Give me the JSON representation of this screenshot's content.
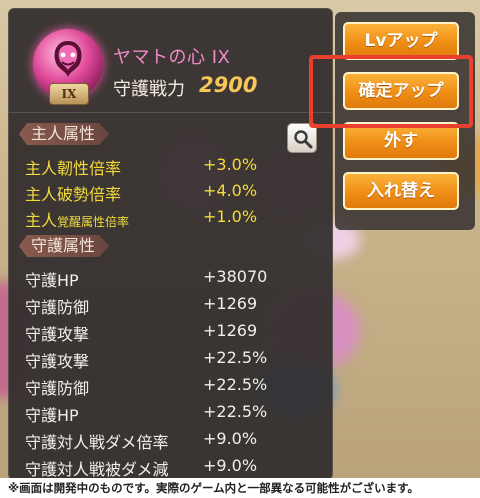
{
  "item": {
    "name": "ヤマトの心 IX",
    "rank": "IX",
    "power_label": "守護戦力",
    "power_value": "2900"
  },
  "owner_section": {
    "title": "主人属性",
    "rows": [
      {
        "label": "主人韌性倍率",
        "value": "+3.0%"
      },
      {
        "label": "主人破勢倍率",
        "value": "+4.0%"
      },
      {
        "label_main": "主人",
        "label_small": "覚醒属性倍率",
        "value": "+1.0%"
      }
    ]
  },
  "guard_section": {
    "title": "守護属性",
    "rows": [
      {
        "label": "守護HP",
        "value": "+38070"
      },
      {
        "label": "守護防御",
        "value": "+1269"
      },
      {
        "label": "守護攻撃",
        "value": "+1269"
      },
      {
        "label": "守護攻撃",
        "value": "+22.5%"
      },
      {
        "label": "守護防御",
        "value": "+22.5%"
      },
      {
        "label": "守護HP",
        "value": "+22.5%"
      },
      {
        "label": "守護対人戦ダメ倍率",
        "value": "+9.0%"
      },
      {
        "label": "守護対人戦被ダメ減",
        "value": "+9.0%"
      }
    ]
  },
  "buttons": {
    "level_up": "Lvアップ",
    "confirm_up": "確定アップ",
    "remove": "外す",
    "swap": "入れ替え"
  },
  "icons": {
    "emblem": "snake-emblem-icon",
    "search": "magnifier-icon"
  },
  "colors": {
    "accent_orange": "#ef8e16",
    "highlight_red": "#e8402c",
    "stat_yellow": "#f3da3c",
    "item_pink": "#f08ac8",
    "power_gold": "#f7c55a"
  },
  "footer_note": "※画面は開発中のものです。実際のゲーム内と一部異なる可能性がございます。"
}
